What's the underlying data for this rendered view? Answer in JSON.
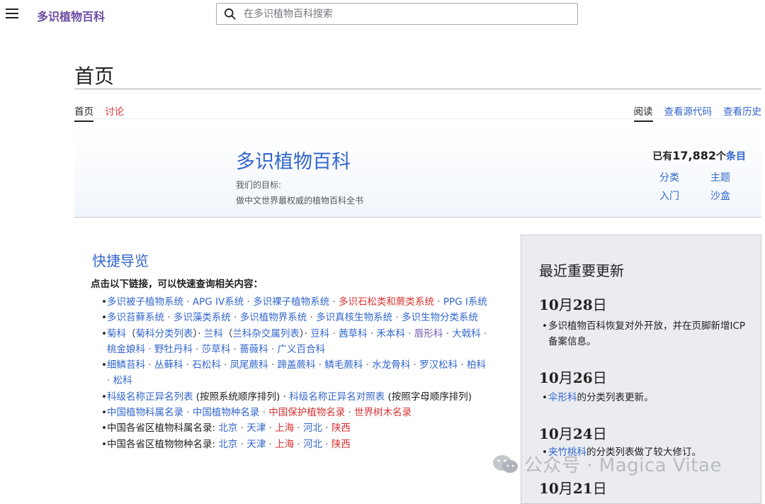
{
  "header": {
    "site_title": "多识植物百科",
    "search_placeholder": "在多识植物百科搜索"
  },
  "page": {
    "title": "首页",
    "tabs_left": [
      "首页",
      "讨论"
    ],
    "tabs_right": [
      "阅读",
      "查看源代码",
      "查看历史"
    ]
  },
  "banner": {
    "title": "多识植物百科",
    "goal_label": "我们的目标:",
    "goal_text": "做中文世界最权威的植物百科全书",
    "stat_prefix": "已有",
    "stat_count": "17,882",
    "stat_unit": "个",
    "stat_link": "条目",
    "links": [
      "分类",
      "主题",
      "入门",
      "沙盒"
    ]
  },
  "quick_nav": {
    "title": "快捷导览",
    "lead": "点击以下链接，可以快速查询相关内容：",
    "items": [
      {
        "parts": [
          [
            "多识被子植物系统",
            "b"
          ],
          [
            " · ",
            "s"
          ],
          [
            "APG IV系统",
            "b"
          ],
          [
            " · ",
            "s"
          ],
          [
            "多识裸子植物系统",
            "b"
          ],
          [
            " · ",
            "s"
          ],
          [
            "多识石松类和蕨类系统",
            "r"
          ],
          [
            " · ",
            "s"
          ],
          [
            "PPG I系统",
            "b"
          ]
        ]
      },
      {
        "parts": [
          [
            "多识苔藓系统",
            "b"
          ],
          [
            " · ",
            "s"
          ],
          [
            "多识藻类系统",
            "b"
          ],
          [
            " · ",
            "s"
          ],
          [
            "多识植物界系统",
            "b"
          ],
          [
            " · ",
            "s"
          ],
          [
            "多识真核生物系统",
            "b"
          ],
          [
            " · ",
            "s"
          ],
          [
            "多识生物分类系统",
            "b"
          ]
        ]
      },
      {
        "parts": [
          [
            "菊科",
            "b"
          ],
          [
            "（",
            "t"
          ],
          [
            "菊科分类列表",
            "b"
          ],
          [
            "）· ",
            "t"
          ],
          [
            "兰科",
            "b"
          ],
          [
            "（",
            "t"
          ],
          [
            "兰科杂交属列表",
            "b"
          ],
          [
            "）· ",
            "t"
          ],
          [
            "豆科",
            "b"
          ],
          [
            " · ",
            "s"
          ],
          [
            "茜草科",
            "b"
          ],
          [
            " · ",
            "s"
          ],
          [
            "禾本科",
            "b"
          ],
          [
            " · ",
            "s"
          ],
          [
            "唇形科",
            "p"
          ],
          [
            " · ",
            "s"
          ],
          [
            "大戟科",
            "b"
          ],
          [
            " · ",
            "s"
          ],
          [
            "桃金娘科",
            "b"
          ],
          [
            " · ",
            "s"
          ],
          [
            "野牡丹科",
            "b"
          ],
          [
            " · ",
            "s"
          ],
          [
            "莎草科",
            "b"
          ],
          [
            " · ",
            "s"
          ],
          [
            "蔷薇科",
            "b"
          ],
          [
            " · ",
            "s"
          ],
          [
            "广义百合科",
            "b"
          ]
        ]
      },
      {
        "parts": [
          [
            "细鳞苔科",
            "b"
          ],
          [
            " · ",
            "s"
          ],
          [
            "丛藓科",
            "b"
          ],
          [
            " · ",
            "s"
          ],
          [
            "石松科",
            "b"
          ],
          [
            " · ",
            "s"
          ],
          [
            "凤尾蕨科",
            "b"
          ],
          [
            " · ",
            "s"
          ],
          [
            "蹄盖蕨科",
            "b"
          ],
          [
            " · ",
            "s"
          ],
          [
            "鳞毛蕨科",
            "b"
          ],
          [
            " · ",
            "s"
          ],
          [
            "水龙骨科",
            "b"
          ],
          [
            " · ",
            "s"
          ],
          [
            "罗汉松科",
            "b"
          ],
          [
            " · ",
            "s"
          ],
          [
            "柏科",
            "b"
          ],
          [
            " · ",
            "s"
          ],
          [
            "松科",
            "b"
          ]
        ]
      },
      {
        "parts": [
          [
            "科级名称正异名列表",
            "b"
          ],
          [
            " (按照系统顺序排列) · ",
            "t"
          ],
          [
            "科级名称正异名对照表",
            "b"
          ],
          [
            " (按照字母顺序排列)",
            "t"
          ]
        ]
      },
      {
        "parts": [
          [
            "中国植物科属名录",
            "b"
          ],
          [
            " · ",
            "s"
          ],
          [
            "中国植物种名录",
            "b"
          ],
          [
            " · ",
            "s"
          ],
          [
            "中国保护植物名录",
            "r"
          ],
          [
            " · ",
            "s"
          ],
          [
            "世界树木名录",
            "r"
          ]
        ]
      },
      {
        "parts": [
          [
            "中国各省区植物科属名录: ",
            "t"
          ],
          [
            "北京",
            "b"
          ],
          [
            " · ",
            "s"
          ],
          [
            "天津",
            "b"
          ],
          [
            " · ",
            "s"
          ],
          [
            "上海",
            "r"
          ],
          [
            " · ",
            "s"
          ],
          [
            "河北",
            "b"
          ],
          [
            " · ",
            "s"
          ],
          [
            "陕西",
            "r"
          ]
        ]
      },
      {
        "parts": [
          [
            "中国各省区植物物种名录: ",
            "t"
          ],
          [
            "北京",
            "b"
          ],
          [
            " · ",
            "s"
          ],
          [
            "天津",
            "b"
          ],
          [
            " · ",
            "s"
          ],
          [
            "上海",
            "r"
          ],
          [
            " · ",
            "s"
          ],
          [
            "河北",
            "b"
          ],
          [
            " · ",
            "s"
          ],
          [
            "陕西",
            "r"
          ]
        ]
      }
    ]
  },
  "updates": {
    "title": "最近重要更新",
    "entries": [
      {
        "date_num1": "10",
        "date_m": "月",
        "date_num2": "28",
        "date_d": "日",
        "text_pre": "",
        "link": "",
        "text": "多识植物百科恢复对外开放，并在页脚新增ICP备案信息。"
      },
      {
        "date_num1": "10",
        "date_m": "月",
        "date_num2": "26",
        "date_d": "日",
        "text_pre": "",
        "link": "伞形科",
        "text": "的分类列表更新。"
      },
      {
        "date_num1": "10",
        "date_m": "月",
        "date_num2": "24",
        "date_d": "日",
        "text_pre": "",
        "link": "夹竹桃科",
        "text": "的分类列表做了较大修订。"
      },
      {
        "date_num1": "10",
        "date_m": "月",
        "date_num2": "21",
        "date_d": "日",
        "text_pre": "",
        "link": "",
        "text": ""
      }
    ]
  },
  "watermark": {
    "text": "公众号 · Magica Vitae"
  },
  "colors": {
    "link": "#3366cc",
    "redlink": "#d73333",
    "visited": "#795cb2",
    "site_title": "#6b4ba1"
  }
}
